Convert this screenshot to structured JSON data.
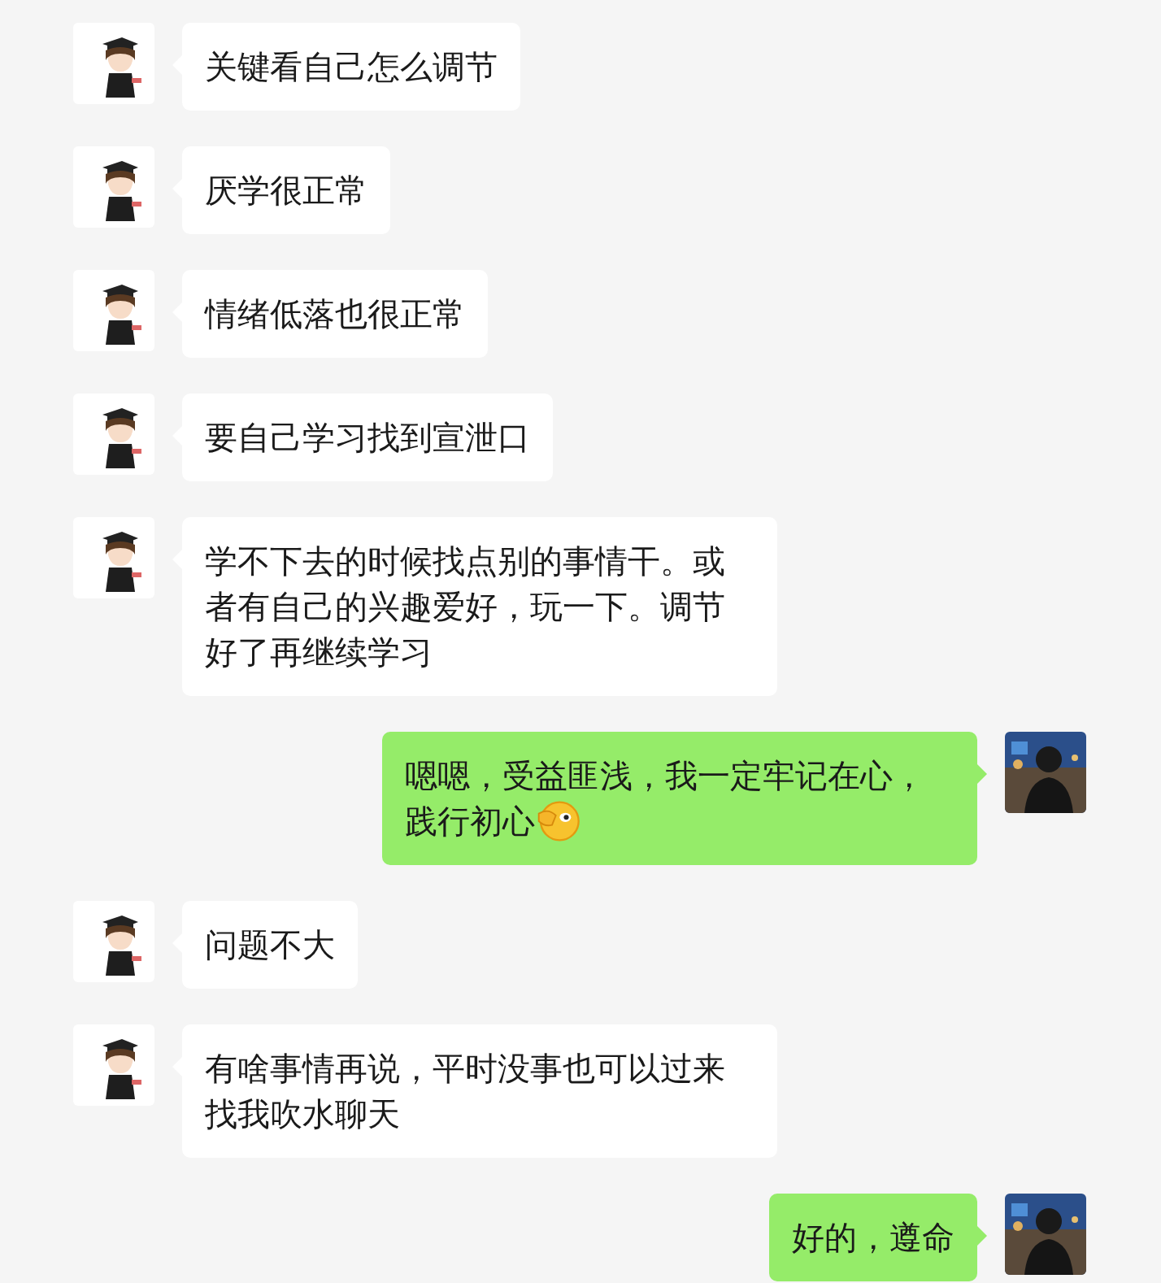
{
  "messages": [
    {
      "kind": "received",
      "text": "关键看自己怎么调节"
    },
    {
      "kind": "received",
      "text": "厌学很正常"
    },
    {
      "kind": "received",
      "text": "情绪低落也很正常"
    },
    {
      "kind": "received",
      "text": "要自己学习找到宣泄口"
    },
    {
      "kind": "received",
      "text": "学不下去的时候找点别的事情干。或者有自己的兴趣爱好，玩一下。调节好了再继续学习"
    },
    {
      "kind": "sent",
      "text": "嗯嗯，受益匪浅，我一定牢记在心，践行初心",
      "emoji": true
    },
    {
      "kind": "received",
      "text": "问题不大"
    },
    {
      "kind": "received",
      "text": "有啥事情再说，平时没事也可以过来找我吹水聊天"
    },
    {
      "kind": "sent",
      "text": "好的，遵命"
    }
  ]
}
